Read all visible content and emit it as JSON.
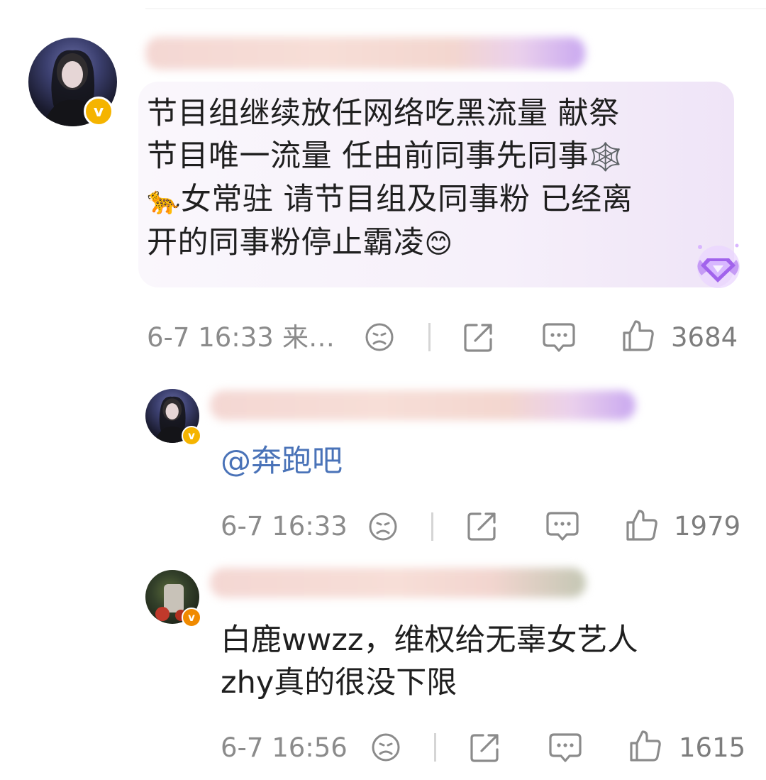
{
  "comments": [
    {
      "text_line1": "节目组继续放任网络吃黑流量 献祭",
      "text_line2": "节目唯一流量 任由前同事先同事",
      "text_line3": "女常驻 请节目组及同事粉 已经离",
      "text_line4": "开的同事粉停止霸凌",
      "emoji_spider": "🕸️",
      "emoji_leopard": "🐆",
      "emoji_smile": "😊",
      "time": "6-7 16:33",
      "source": "来…",
      "likes": "3684"
    },
    {
      "mention": "@奔跑吧",
      "time": "6-7 16:33",
      "likes": "1979"
    },
    {
      "text_line1": "白鹿wwzz，维权给无辜女艺人",
      "text_line2": "zhy真的很没下限",
      "time": "6-7 16:56",
      "likes": "1615"
    }
  ],
  "badge": {
    "letter": "v",
    "color": "#f5b400"
  },
  "icons": {
    "dislike": "sad-face-icon",
    "share": "share-icon",
    "reply": "comment-bubble-icon",
    "like": "thumbs-up-icon",
    "vip": "purple-gem-badge-icon"
  }
}
